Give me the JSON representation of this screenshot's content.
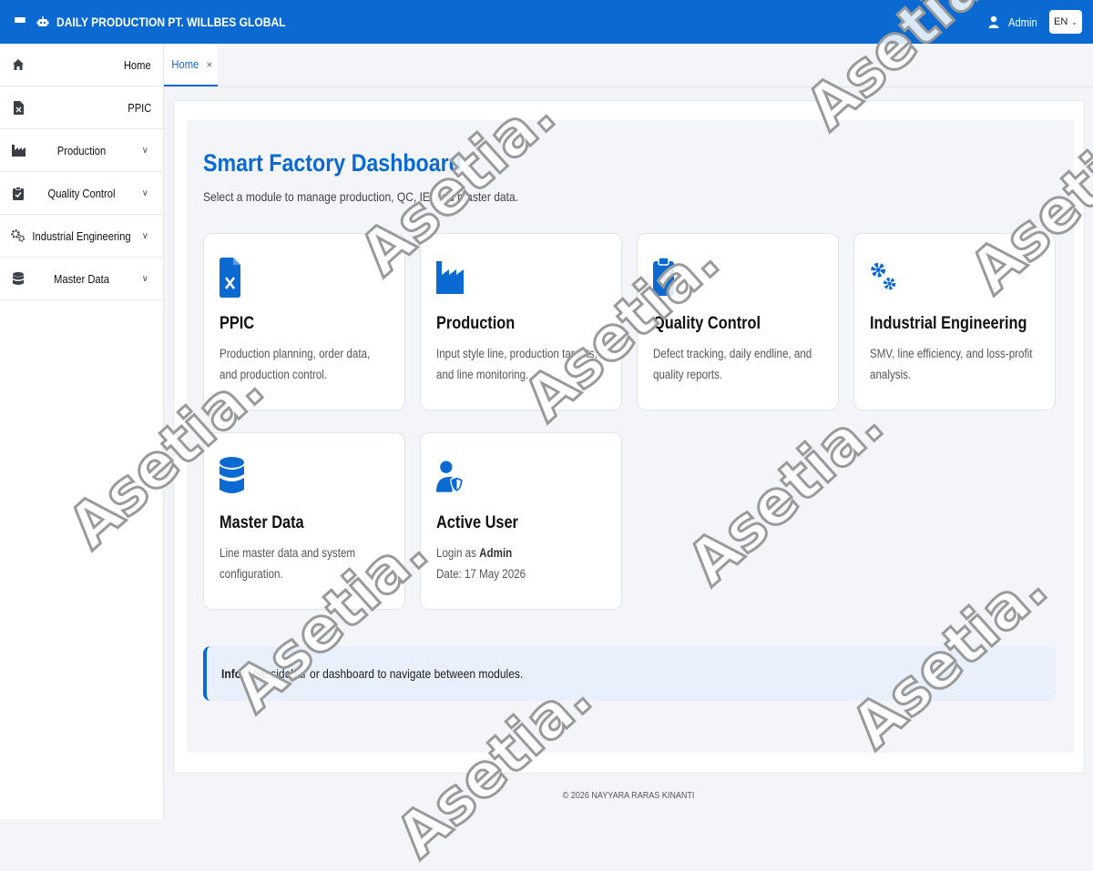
{
  "app": {
    "title": "DAILY PRODUCTION PT. WILLBES GLOBAL",
    "user": "Admin",
    "language": "EN",
    "colors": {
      "primary": "#0b6ad2",
      "background": "#f3f5f9",
      "info_bg": "#e7f0fb"
    }
  },
  "sidebar": {
    "items": [
      {
        "label": "Home",
        "icon": "home-icon",
        "has_submenu": false
      },
      {
        "label": "PPIC",
        "icon": "file-excel-icon",
        "has_submenu": false
      },
      {
        "label": "Production",
        "icon": "industry-icon",
        "has_submenu": true
      },
      {
        "label": "Quality Control",
        "icon": "clipboard-check-icon",
        "has_submenu": true
      },
      {
        "label": "Industrial Engineering",
        "icon": "gears-icon",
        "has_submenu": true
      },
      {
        "label": "Master Data",
        "icon": "database-icon",
        "has_submenu": true
      }
    ]
  },
  "tabs": [
    {
      "label": "Home",
      "close": "×",
      "active": true
    }
  ],
  "dashboard": {
    "title": "Smart Factory Dashboard",
    "subtitle": "Select a module to manage production, QC, IE, and master data.",
    "cards": [
      {
        "title": "PPIC",
        "description": "Production planning, order data, and production control.",
        "icon": "file-excel-icon"
      },
      {
        "title": "Production",
        "description": "Input style line, production targets, and line monitoring.",
        "icon": "industry-icon"
      },
      {
        "title": "Quality Control",
        "description": "Defect tracking, daily endline, and quality reports.",
        "icon": "clipboard-check-icon"
      },
      {
        "title": "Industrial Engineering",
        "description": "SMV, line efficiency, and loss-profit analysis.",
        "icon": "gears-icon"
      },
      {
        "title": "Master Data",
        "description": "Line master data and system configuration.",
        "icon": "database-icon"
      }
    ],
    "active_user": {
      "title": "Active User",
      "login_prefix": "Login as",
      "login_user": "Admin",
      "date_label": "Date: 17 May 2026",
      "icon": "user-shield-icon"
    },
    "info": {
      "label": "Info:",
      "text": "Use sidebar or dashboard to navigate between modules."
    }
  },
  "footer": {
    "text": "© 2026 NAYYARA RARAS KINANTI"
  },
  "watermark": {
    "text": "Asetia."
  }
}
